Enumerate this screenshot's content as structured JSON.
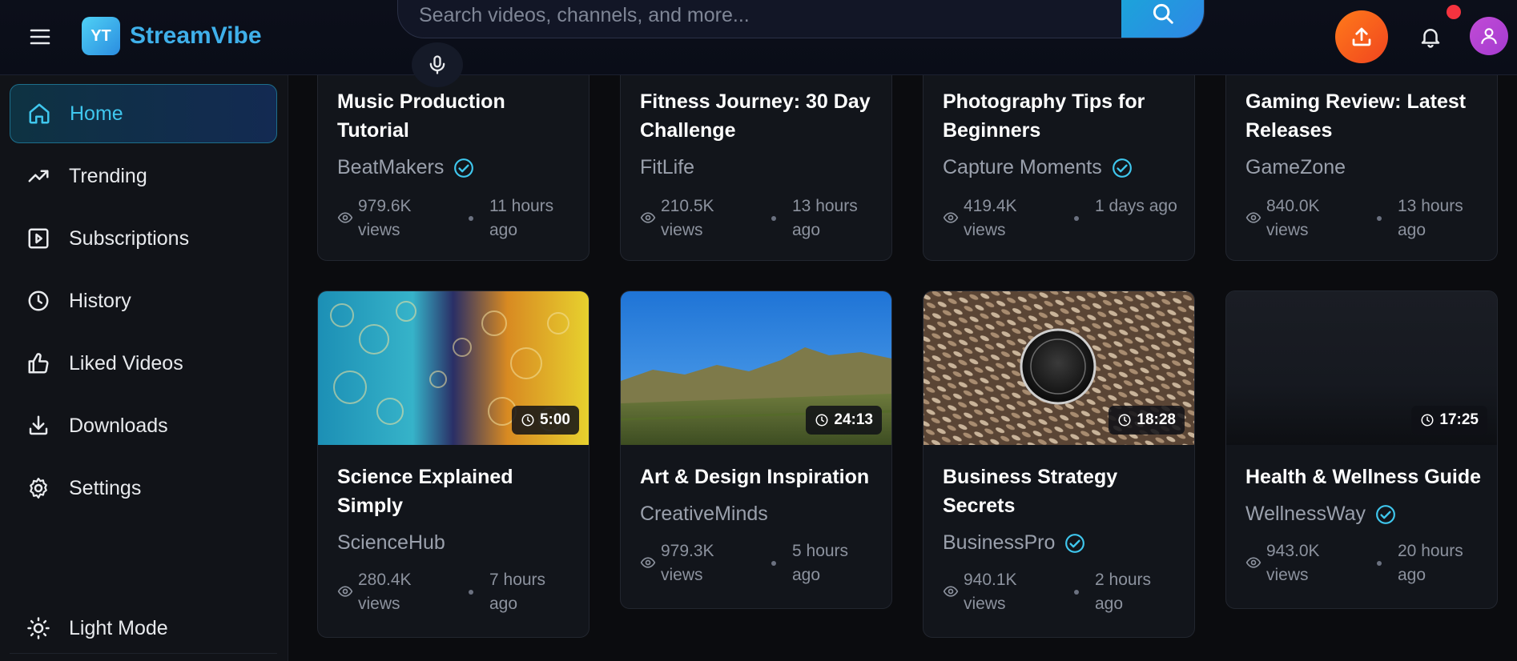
{
  "header": {
    "logo_badge": "YT",
    "app_name": "StreamVibe",
    "search_placeholder": "Search videos, channels, and more..."
  },
  "sidebar": {
    "items": [
      {
        "label": "Home",
        "icon": "home-icon",
        "active": true
      },
      {
        "label": "Trending",
        "icon": "trending-icon"
      },
      {
        "label": "Subscriptions",
        "icon": "subscriptions-icon"
      },
      {
        "label": "History",
        "icon": "history-icon"
      },
      {
        "label": "Liked Videos",
        "icon": "thumbs-up-icon"
      },
      {
        "label": "Downloads",
        "icon": "download-icon"
      },
      {
        "label": "Settings",
        "icon": "gear-icon"
      }
    ],
    "theme_toggle": "Light Mode"
  },
  "videos_row1": [
    {
      "title": "Music Production Tutorial",
      "channel": "BeatMakers",
      "verified": true,
      "views": "979.6K views",
      "ago": "11 hours ago"
    },
    {
      "title": "Fitness Journey: 30 Day Challenge",
      "channel": "FitLife",
      "verified": false,
      "views": "210.5K views",
      "ago": "13 hours ago"
    },
    {
      "title": "Photography Tips for Beginners",
      "channel": "Capture Moments",
      "verified": true,
      "views": "419.4K views",
      "ago": "1 days ago"
    },
    {
      "title": "Gaming Review: Latest Releases",
      "channel": "GameZone",
      "verified": false,
      "views": "840.0K views",
      "ago": "13 hours ago"
    }
  ],
  "videos_row2": [
    {
      "title": "Science Explained Simply",
      "channel": "ScienceHub",
      "verified": false,
      "views": "280.4K views",
      "ago": "7 hours ago",
      "duration": "5:00"
    },
    {
      "title": "Art & Design Inspiration",
      "channel": "CreativeMinds",
      "verified": false,
      "views": "979.3K views",
      "ago": "5 hours ago",
      "duration": "24:13"
    },
    {
      "title": "Business Strategy Secrets",
      "channel": "BusinessPro",
      "verified": true,
      "views": "940.1K views",
      "ago": "2 hours ago",
      "duration": "18:28"
    },
    {
      "title": "Health & Wellness Guide",
      "channel": "WellnessWay",
      "verified": true,
      "views": "943.0K views",
      "ago": "20 hours ago",
      "duration": "17:25"
    }
  ],
  "colors": {
    "accent": "#3fb0ea",
    "upload": "#f0451f",
    "notification_dot": "#f5333f",
    "avatar": "#b444d4",
    "verified": "#3fc7ee"
  }
}
